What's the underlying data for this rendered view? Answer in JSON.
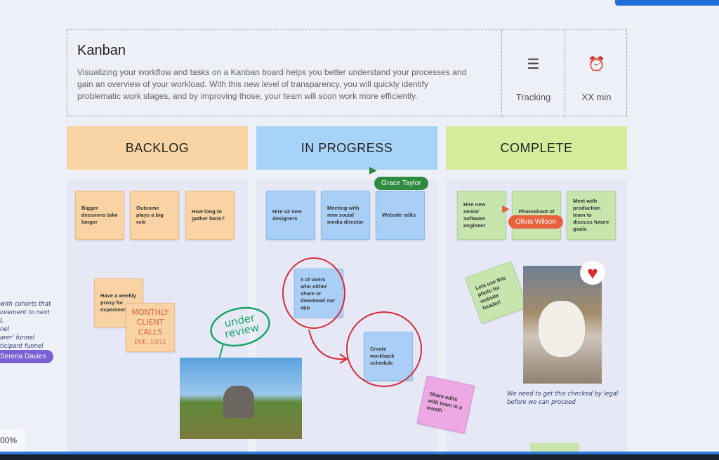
{
  "header": {
    "title": "Kanban",
    "description": "Visualizing your workflow and tasks on a Kanban board helps you better understand your processes and gain an overview of your workload. With this new level of transparency, you will quickly identify problematic work stages, and by improving those, your team will soon work more efficiently.",
    "meta": [
      {
        "icon": "checklist-icon",
        "label": "Tracking"
      },
      {
        "icon": "alarm-clock-icon",
        "label": "XX min"
      }
    ]
  },
  "columns": [
    {
      "title": "BACKLOG",
      "color": "#f8d3a3",
      "notes": [
        "Bigger decisions take longer",
        "Outcome plays a big role",
        "How long to gather facts?"
      ]
    },
    {
      "title": "IN PROGRESS",
      "color": "#a8d3f8",
      "notes": [
        "Hire x2 new designers",
        "Meeting with new social media director",
        "Website edits"
      ]
    },
    {
      "title": "COMPLETE",
      "color": "#d4ec9b",
      "notes": [
        "Hire new senior software engineer",
        "Photoshoot of",
        "Meet with production team to discuss future goals"
      ]
    }
  ],
  "extras": {
    "weekly": "Have a weekly proxy for experiments",
    "monthly": [
      "MONTHLY",
      "CLIENT",
      "CALLS",
      "DUE: 10/11"
    ],
    "under_review": "under review",
    "users": "# of users who either share or download our app",
    "workback": "Create workback schedule",
    "share": "Share edits with team in a month",
    "lets": "Lets use this photo for website header!",
    "legal": "We need to get this checked by legal before we can proceed"
  },
  "cursors": [
    {
      "name": "Grace Taylor",
      "color": "#2e8b3e"
    },
    {
      "name": "Olivia Wilson",
      "color": "#e8603c"
    },
    {
      "name": "Serena Davies",
      "color": "#7a5fd6"
    }
  ],
  "left_notes": [
    "with cohorts that",
    "ovement to next",
    "l,",
    "nel",
    "arer' funnel",
    "ticipant funnel"
  ],
  "zoom": "00%"
}
